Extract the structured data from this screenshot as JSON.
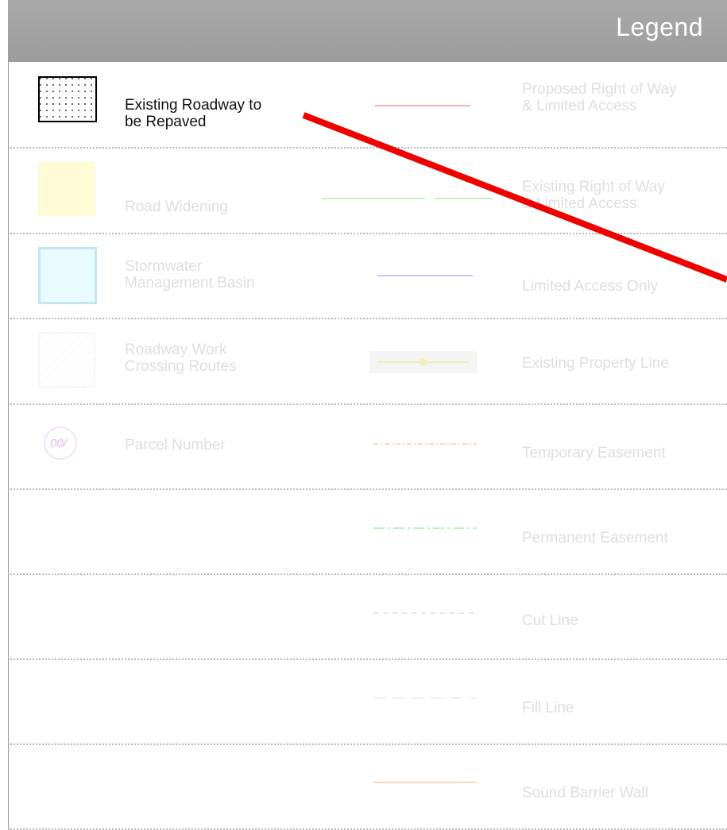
{
  "title": "Legend",
  "rows": [
    {
      "left": {
        "label": "Existing Roadway to\nbe Repaved",
        "icon": "dotted-square-icon",
        "color": "#000000",
        "highlighted": true
      },
      "right": {
        "label": "Proposed Right of Way\n& Limited Access",
        "icon": "red-line-icon",
        "color": "#ff8080"
      }
    },
    {
      "left": {
        "label": "Road Widening",
        "icon": "yellow-square-icon",
        "color": "#fffad0"
      },
      "right": {
        "label": "Existing Right of Way\n& Limited Access",
        "icon": "green-line-icon",
        "color": "#9adf9a"
      }
    },
    {
      "left": {
        "label": "Stormwater\nManagement Basin",
        "icon": "blue-square-icon",
        "color": "#dff8ff"
      },
      "right": {
        "label": "Limited Access Only",
        "icon": "purple-line-icon",
        "color": "#a8a8e8"
      }
    },
    {
      "left": {
        "label": "Roadway Work\nCrossing Routes",
        "icon": "hatched-square-icon",
        "color": "#f7eeee"
      },
      "right": {
        "label": "Existing Property Line",
        "icon": "property-line-icon",
        "color": "#e8e8a0"
      }
    },
    {
      "left": {
        "label": "Parcel Number",
        "icon": "parcel-circle-icon",
        "color": "#f2a0f2",
        "badge": "00/"
      },
      "right": {
        "label": "Temporary Easement",
        "icon": "orange-dashed-line-icon",
        "color": "#f0c890"
      }
    },
    {
      "right": {
        "label": "Permanent Easement",
        "icon": "green-dashdot-line-icon",
        "color": "#a0e8a0"
      }
    },
    {
      "right": {
        "label": "Cut Line",
        "icon": "gray-dashed-line-icon",
        "color": "#e0e0e0"
      }
    },
    {
      "right": {
        "label": "Fill Line",
        "icon": "light-dashed-line-icon",
        "color": "#e6eef0"
      }
    },
    {
      "right": {
        "label": "Sound Barrier Wall",
        "icon": "orange-line-icon",
        "color": "#f8c898"
      }
    }
  ],
  "annotation": {
    "type": "arrow",
    "color": "#ee0000",
    "icon": "red-pointer-arrow-icon"
  }
}
